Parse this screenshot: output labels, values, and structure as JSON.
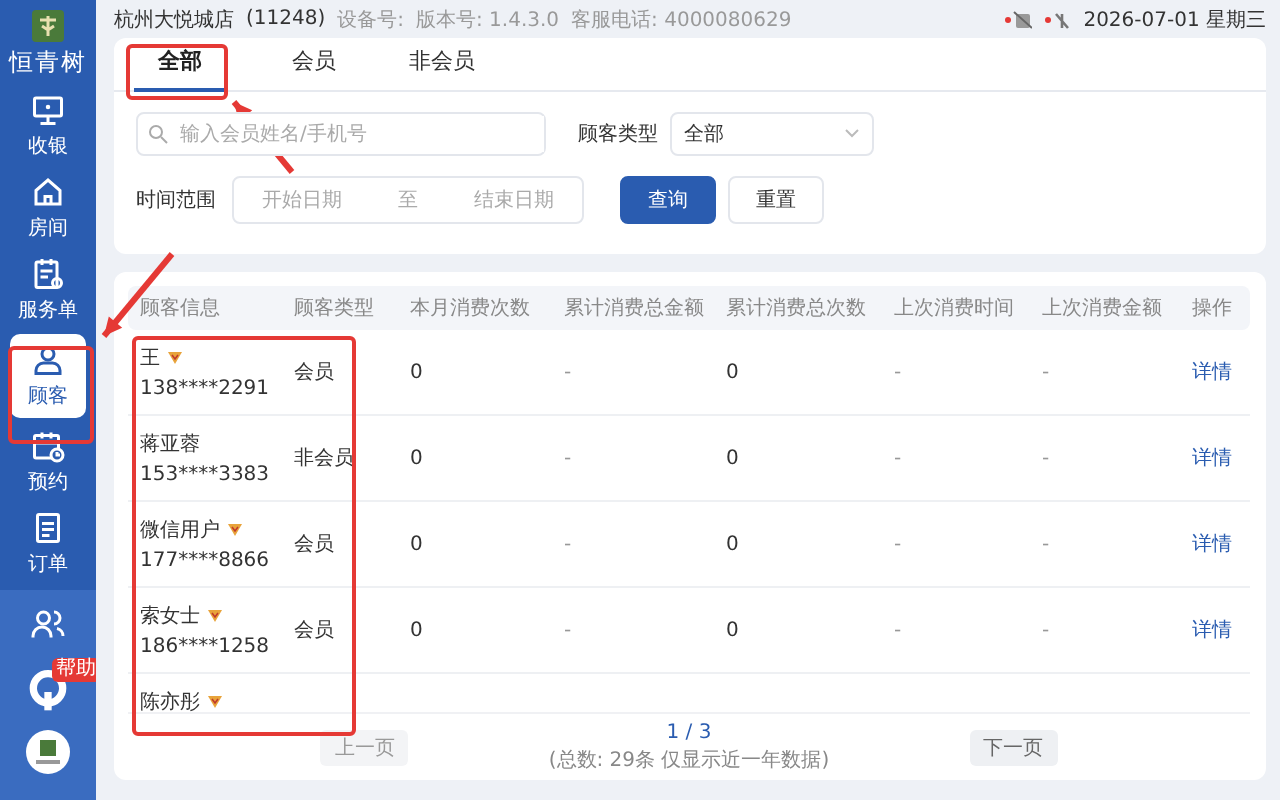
{
  "top_bar": {
    "store": "杭州大悦城店",
    "store_code": "(11248)",
    "device": "设备号:",
    "version": "版本号: 1.4.3.0",
    "hotline": "客服电话: 4000080629",
    "date": "2026-07-01 星期三"
  },
  "sidebar": {
    "logo": "恒青树",
    "items": [
      {
        "label": "收银",
        "selected": false
      },
      {
        "label": "房间",
        "selected": false
      },
      {
        "label": "服务单",
        "selected": false
      },
      {
        "label": "顾客",
        "selected": true
      },
      {
        "label": "预约",
        "selected": false
      },
      {
        "label": "订单",
        "selected": false
      },
      {
        "selected": false
      }
    ],
    "help": {
      "badge": "帮助"
    }
  },
  "tabs": [
    {
      "label": "全部",
      "selected": true
    },
    {
      "label": "会员",
      "selected": false
    },
    {
      "label": "非会员",
      "selected": false
    }
  ],
  "filters": {
    "search": {
      "placeholder": "输入会员姓名/手机号"
    },
    "type_label": "顾客类型",
    "type_value": "全部",
    "range_label": "时间范围",
    "start_placeholder": "开始日期",
    "range_sep": "至",
    "end_placeholder": "结束日期",
    "query": "查询",
    "reset": "重置"
  },
  "table": {
    "columns": [
      "顾客信息",
      "顾客类型",
      "本月消费次数",
      "累计消费总金额",
      "累计消费总次数",
      "上次消费时间",
      "上次消费金额",
      "操作"
    ],
    "rows": [
      {
        "name": "王",
        "member": true,
        "phone": "138****2291",
        "cells": [
          "会员",
          "0",
          "-",
          "0",
          "-",
          "-"
        ],
        "action": "详情"
      },
      {
        "name": "蒋亚蓉",
        "member": false,
        "phone": "153****3383",
        "cells": [
          "非会员",
          "0",
          "-",
          "0",
          "-",
          "-"
        ],
        "action": "详情"
      },
      {
        "name": "微信用户",
        "member": true,
        "phone": "177****8866",
        "cells": [
          "会员",
          "0",
          "-",
          "0",
          "-",
          "-"
        ],
        "action": "详情"
      },
      {
        "name": "索女士",
        "member": true,
        "phone": "186****1258",
        "cells": [
          "会员",
          "0",
          "-",
          "0",
          "-",
          "-"
        ],
        "action": "详情"
      },
      {
        "name": "陈亦彤",
        "member": true
      }
    ]
  },
  "pagination": {
    "prev": {
      "label": "上一页",
      "disabled": true
    },
    "page": "1 / 3",
    "total": "(总数: 29条 仅显示近一年数据)",
    "next": {
      "label": "下一页",
      "disabled": false
    }
  }
}
